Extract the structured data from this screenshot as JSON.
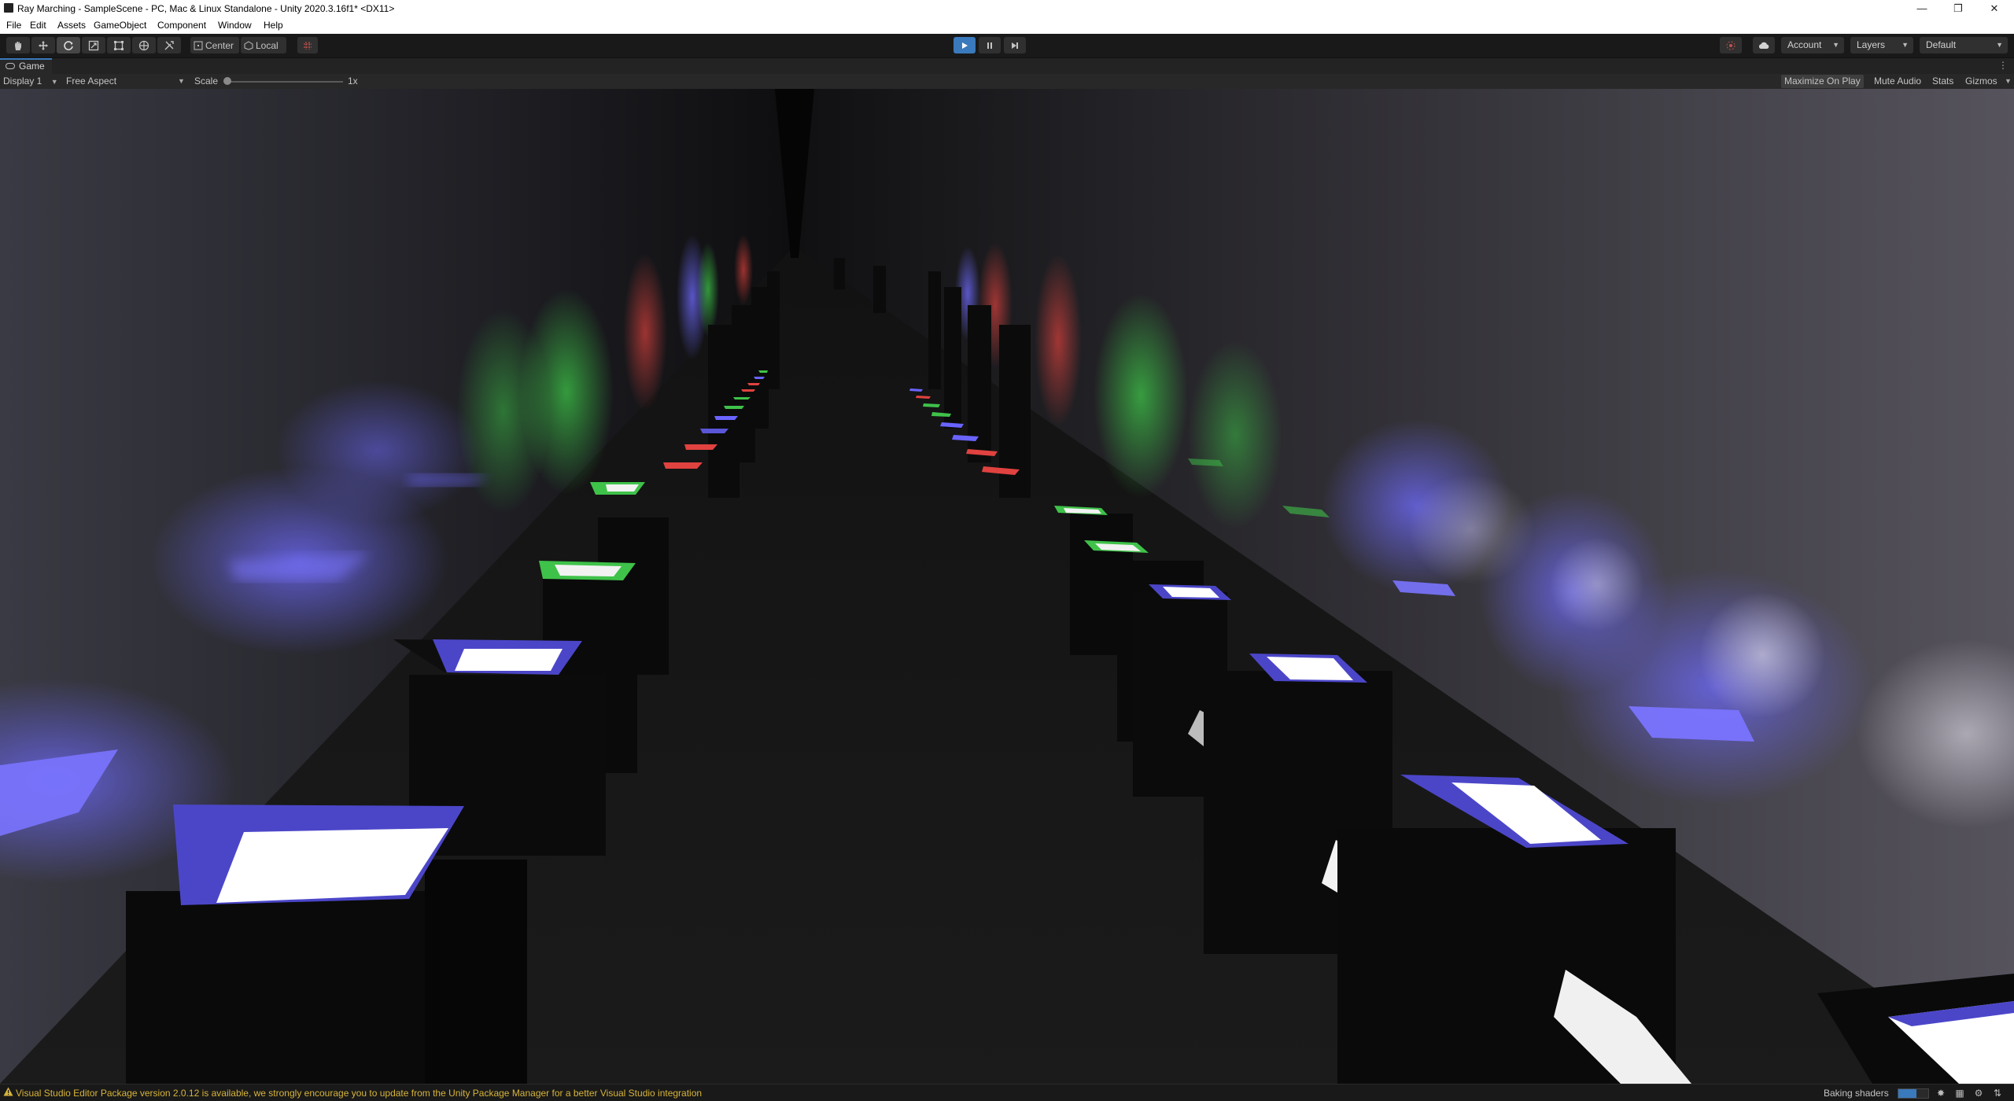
{
  "window": {
    "title": "Ray Marching - SampleScene - PC, Mac & Linux Standalone - Unity 2020.3.16f1* <DX11>",
    "controls": [
      "minimize-icon",
      "restore-icon",
      "close-icon"
    ]
  },
  "menu": {
    "items": [
      "File",
      "Edit",
      "Assets",
      "GameObject",
      "Component",
      "Window",
      "Help"
    ]
  },
  "toolbar": {
    "tools": [
      "hand-tool-icon",
      "move-tool-icon",
      "rotate-tool-icon",
      "scale-tool-icon",
      "rect-tool-icon",
      "transform-tool-icon",
      "custom-tool-icon"
    ],
    "active_tool": "rotate-tool-icon",
    "pivot_center": "Center",
    "pivot_local": "Local",
    "play_state": "playing",
    "account_label": "Account",
    "layers_label": "Layers",
    "layout_label": "Default"
  },
  "game_tab": {
    "label": "Game"
  },
  "game_bar": {
    "display": "Display 1",
    "aspect": "Free Aspect",
    "scale_label": "Scale",
    "scale_value": "1x",
    "maximize_on_play": "Maximize On Play",
    "mute_audio": "Mute Audio",
    "stats": "Stats",
    "gizmos": "Gizmos"
  },
  "status": {
    "message": "Visual Studio Editor Package version 2.0.12 is available, we strongly encourage you to update from the Unity Package Manager for a better Visual Studio integration",
    "baking_label": "Baking shaders",
    "baking_progress": 0.6
  },
  "colors": {
    "accent": "#3a79bb",
    "warning": "#d7b43a",
    "light_blue": "#6a64ff",
    "light_green": "#3fc24a",
    "light_red": "#e0423f"
  }
}
